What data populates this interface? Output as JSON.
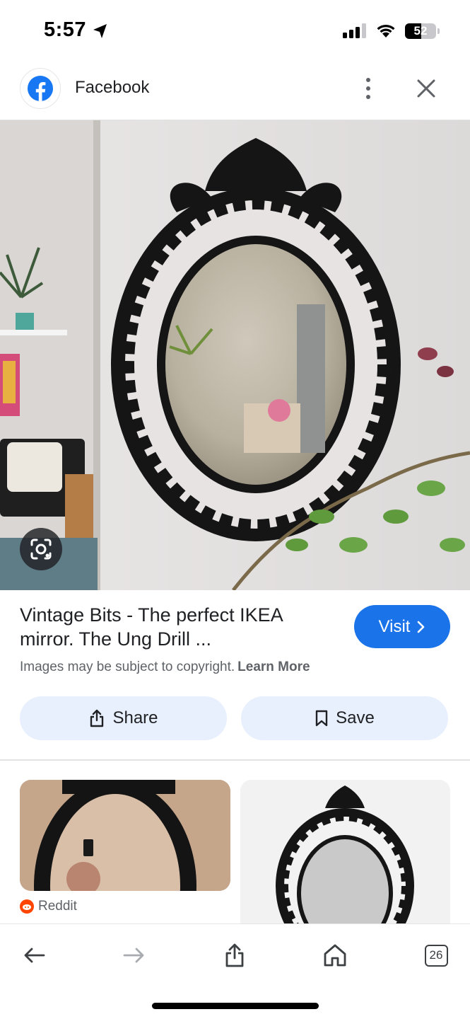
{
  "status_bar": {
    "time": "5:57",
    "battery_percent": "52",
    "battery_level": 0.52,
    "signal_bars_filled": 3,
    "location_icon": "location-arrow-icon",
    "wifi_icon": "wifi-icon"
  },
  "header": {
    "source_name": "Facebook",
    "source_logo_icon": "facebook-logo",
    "brand_color": "#1877f2"
  },
  "result": {
    "title_line1": "Vintage Bits - The perfect IKEA",
    "title_line2": "mirror. The Ung Drill ...",
    "visit_label": "Visit",
    "copyright_text": "Images may be subject to copyright.",
    "learn_more_label": "Learn More",
    "share_label": "Share",
    "save_label": "Save",
    "accent_color": "#1a73e8"
  },
  "related": {
    "items": [
      {
        "source": "Reddit",
        "source_icon": "reddit-icon"
      },
      {
        "source": ""
      }
    ]
  },
  "toolbar": {
    "tab_count": "26"
  }
}
